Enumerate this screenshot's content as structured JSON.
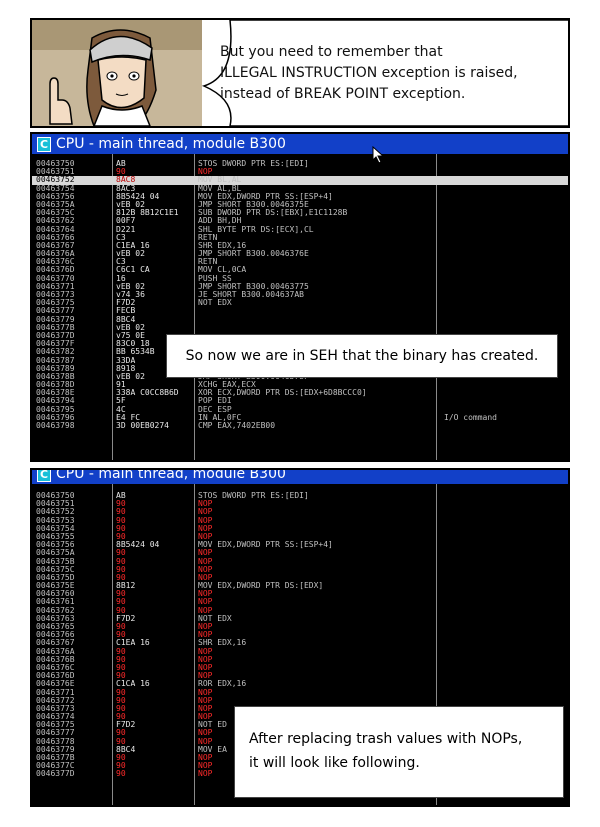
{
  "panel1": {
    "speech_lines": [
      "But you need to remember that",
      "ILLEGAL INSTRUCTION exception is raised,",
      "instead of BREAK POINT exception."
    ]
  },
  "panel2": {
    "title": "CPU - main thread, module B300",
    "icon_letter": "C",
    "caption": "So now we are in SEH that the binary has created.",
    "rows": [
      {
        "addr": "00463750",
        "hex": "AB",
        "dis": "STOS DWORD PTR ES:[EDI]",
        "cmt": ""
      },
      {
        "addr": "00463751",
        "hex": "90",
        "dis": "NOP",
        "cmt": "",
        "nop": true
      },
      {
        "addr": "00463752",
        "hex": "8AC8",
        "dis": "MOV BL,AL",
        "cmt": "",
        "sel": true
      },
      {
        "addr": "00463754",
        "hex": "8AC3",
        "dis": "MOV AL,BL",
        "cmt": ""
      },
      {
        "addr": "00463756",
        "hex": "8B5424 04",
        "dis": "MOV EDX,DWORD PTR SS:[ESP+4]",
        "cmt": ""
      },
      {
        "addr": "0046375A",
        "hex": "vEB 02",
        "dis": "JMP SHORT B300.0046375E",
        "cmt": ""
      },
      {
        "addr": "0046375C",
        "hex": "812B 8B12C1E1",
        "dis": "SUB DWORD PTR DS:[EBX],E1C1128B",
        "cmt": ""
      },
      {
        "addr": "00463762",
        "hex": "00F7",
        "dis": "ADD BH,DH",
        "cmt": ""
      },
      {
        "addr": "00463764",
        "hex": "D221",
        "dis": "SHL BYTE PTR DS:[ECX],CL",
        "cmt": ""
      },
      {
        "addr": "00463766",
        "hex": "C3",
        "dis": "RETN",
        "cmt": ""
      },
      {
        "addr": "00463767",
        "hex": "C1EA 16",
        "dis": "SHR EDX,16",
        "cmt": ""
      },
      {
        "addr": "0046376A",
        "hex": "vEB 02",
        "dis": "JMP SHORT B300.0046376E",
        "cmt": ""
      },
      {
        "addr": "0046376C",
        "hex": "C3",
        "dis": "RETN",
        "cmt": ""
      },
      {
        "addr": "0046376D",
        "hex": "C6C1 CA",
        "dis": "MOV CL,0CA",
        "cmt": ""
      },
      {
        "addr": "00463770",
        "hex": "16",
        "dis": "PUSH SS",
        "cmt": ""
      },
      {
        "addr": "00463771",
        "hex": "vEB 02",
        "dis": "JMP SHORT B300.00463775",
        "cmt": ""
      },
      {
        "addr": "00463773",
        "hex": "v74 36",
        "dis": "JE SHORT B300.004637AB",
        "cmt": ""
      },
      {
        "addr": "00463775",
        "hex": "F7D2",
        "dis": "NOT EDX",
        "cmt": ""
      },
      {
        "addr": "00463777",
        "hex": "FECB",
        "dis": "",
        "cmt": ""
      },
      {
        "addr": "00463779",
        "hex": "8BC4",
        "dis": "",
        "cmt": ""
      },
      {
        "addr": "0046377B",
        "hex": "vEB 02",
        "dis": "",
        "cmt": ""
      },
      {
        "addr": "0046377D",
        "hex": "v75 0E",
        "dis": "",
        "cmt": ""
      },
      {
        "addr": "0046377F",
        "hex": "83C0 18",
        "dis": "",
        "cmt": ""
      },
      {
        "addr": "00463782",
        "hex": "BB 6534B",
        "dis": "",
        "cmt": ""
      },
      {
        "addr": "00463787",
        "hex": "33DA",
        "dis": "",
        "cmt": ""
      },
      {
        "addr": "00463789",
        "hex": "8918",
        "dis": "MOV DWORD PTR DS:[EAX],EBX",
        "cmt": ""
      },
      {
        "addr": "0046378B",
        "hex": "vEB 02",
        "dis": "JMP SHORT B300.0046378F",
        "cmt": ""
      },
      {
        "addr": "0046378D",
        "hex": "91",
        "dis": "XCHG EAX,ECX",
        "cmt": ""
      },
      {
        "addr": "0046378E",
        "hex": "338A C0CC8B6D",
        "dis": "XOR ECX,DWORD PTR DS:[EDX+6D8BCCC0]",
        "cmt": ""
      },
      {
        "addr": "00463794",
        "hex": "5F",
        "dis": "POP EDI",
        "cmt": ""
      },
      {
        "addr": "00463795",
        "hex": "4C",
        "dis": "DEC ESP",
        "cmt": ""
      },
      {
        "addr": "00463796",
        "hex": "E4 FC",
        "dis": "IN AL,0FC",
        "cmt": "I/O command"
      },
      {
        "addr": "00463798",
        "hex": "3D 00EB0274",
        "dis": "CMP EAX,7402EB00",
        "cmt": ""
      }
    ]
  },
  "panel3": {
    "title": "CPU - main thread, module B300",
    "icon_letter": "C",
    "caption_lines": [
      "After replacing trash values with NOPs,",
      "it will look like following."
    ],
    "rows": [
      {
        "addr": "00463750",
        "hex": "AB",
        "dis": "STOS DWORD PTR ES:[EDI]"
      },
      {
        "addr": "00463751",
        "hex": "90",
        "dis": "NOP",
        "nop": true
      },
      {
        "addr": "00463752",
        "hex": "90",
        "dis": "NOP",
        "nop": true
      },
      {
        "addr": "00463753",
        "hex": "90",
        "dis": "NOP",
        "nop": true
      },
      {
        "addr": "00463754",
        "hex": "90",
        "dis": "NOP",
        "nop": true
      },
      {
        "addr": "00463755",
        "hex": "90",
        "dis": "NOP",
        "nop": true
      },
      {
        "addr": "00463756",
        "hex": "8B5424 04",
        "dis": "MOV EDX,DWORD PTR SS:[ESP+4]"
      },
      {
        "addr": "0046375A",
        "hex": "90",
        "dis": "NOP",
        "nop": true
      },
      {
        "addr": "0046375B",
        "hex": "90",
        "dis": "NOP",
        "nop": true
      },
      {
        "addr": "0046375C",
        "hex": "90",
        "dis": "NOP",
        "nop": true
      },
      {
        "addr": "0046375D",
        "hex": "90",
        "dis": "NOP",
        "nop": true
      },
      {
        "addr": "0046375E",
        "hex": "8B12",
        "dis": "MOV EDX,DWORD PTR DS:[EDX]"
      },
      {
        "addr": "00463760",
        "hex": "90",
        "dis": "NOP",
        "nop": true
      },
      {
        "addr": "00463761",
        "hex": "90",
        "dis": "NOP",
        "nop": true
      },
      {
        "addr": "00463762",
        "hex": "90",
        "dis": "NOP",
        "nop": true
      },
      {
        "addr": "00463763",
        "hex": "F7D2",
        "dis": "NOT EDX"
      },
      {
        "addr": "00463765",
        "hex": "90",
        "dis": "NOP",
        "nop": true
      },
      {
        "addr": "00463766",
        "hex": "90",
        "dis": "NOP",
        "nop": true
      },
      {
        "addr": "00463767",
        "hex": "C1EA 16",
        "dis": "SHR EDX,16"
      },
      {
        "addr": "0046376A",
        "hex": "90",
        "dis": "NOP",
        "nop": true
      },
      {
        "addr": "0046376B",
        "hex": "90",
        "dis": "NOP",
        "nop": true
      },
      {
        "addr": "0046376C",
        "hex": "90",
        "dis": "NOP",
        "nop": true
      },
      {
        "addr": "0046376D",
        "hex": "90",
        "dis": "NOP",
        "nop": true
      },
      {
        "addr": "0046376E",
        "hex": "C1CA 16",
        "dis": "ROR EDX,16"
      },
      {
        "addr": "00463771",
        "hex": "90",
        "dis": "NOP",
        "nop": true
      },
      {
        "addr": "00463772",
        "hex": "90",
        "dis": "NOP",
        "nop": true
      },
      {
        "addr": "00463773",
        "hex": "90",
        "dis": "NOP",
        "nop": true
      },
      {
        "addr": "00463774",
        "hex": "90",
        "dis": "NOP",
        "nop": true
      },
      {
        "addr": "00463775",
        "hex": "F7D2",
        "dis": "NOT ED"
      },
      {
        "addr": "00463777",
        "hex": "90",
        "dis": "NOP",
        "nop": true
      },
      {
        "addr": "00463778",
        "hex": "90",
        "dis": "NOP",
        "nop": true
      },
      {
        "addr": "00463779",
        "hex": "8BC4",
        "dis": "MOV EA"
      },
      {
        "addr": "0046377B",
        "hex": "90",
        "dis": "NOP",
        "nop": true
      },
      {
        "addr": "0046377C",
        "hex": "90",
        "dis": "NOP",
        "nop": true
      },
      {
        "addr": "0046377D",
        "hex": "90",
        "dis": "NOP",
        "nop": true
      }
    ]
  },
  "colors": {
    "titlebar": "#1240c8",
    "nop": "#ff2a2a",
    "selected_row": "#d8d8d8",
    "listing_bg": "#000000"
  },
  "icons": [
    "info-icon",
    "mouse-pointer-icon"
  ]
}
